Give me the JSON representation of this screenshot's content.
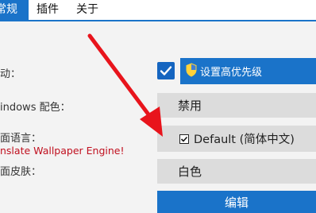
{
  "tabs": [
    {
      "label": "常规",
      "active": true
    },
    {
      "label": "插件",
      "active": false
    },
    {
      "label": "关于",
      "active": false
    }
  ],
  "settings": {
    "startup_label": "动：",
    "windows_color_label": "indows 配色：",
    "ui_language_label": "面语言：",
    "translate_link": "nslate Wallpaper Engine!",
    "ui_skin_label": "面皮肤："
  },
  "controls": {
    "priority_button": "设置高优先级",
    "windows_color_value": "禁用",
    "language_value": "Default (简体中文)",
    "skin_value": "白色",
    "edit_button": "编辑",
    "startup_checked": true
  },
  "colors": {
    "accent": "#1a73c9",
    "annotation_arrow": "#e8141c"
  },
  "icons": [
    "check-icon",
    "shield-icon",
    "annotation-arrow"
  ]
}
